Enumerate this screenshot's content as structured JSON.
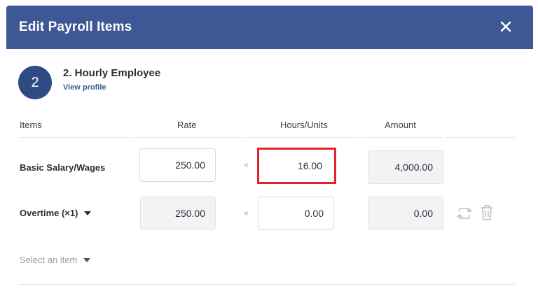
{
  "dialog": {
    "title": "Edit Payroll Items"
  },
  "employee": {
    "number": "2",
    "name": "2. Hourly Employee",
    "link": "View profile"
  },
  "columns": {
    "items": "Items",
    "rate": "Rate",
    "hours": "Hours/Units",
    "amount": "Amount"
  },
  "rows": [
    {
      "label": "Basic Salary/Wages",
      "rate": "250.00",
      "times": "×",
      "hours": "16.00",
      "amount": "4,000.00"
    },
    {
      "label": "Overtime (×1)",
      "rate": "250.00",
      "times": "×",
      "hours": "0.00",
      "amount": "0.00"
    }
  ],
  "add_item": {
    "label": "Select an item"
  },
  "icons": {
    "close": "close-icon",
    "swap": "swap-icon",
    "delete": "trash-icon"
  },
  "colors": {
    "header": "#3d5894",
    "circle": "#2f4b84",
    "highlight": "#e0232c"
  }
}
